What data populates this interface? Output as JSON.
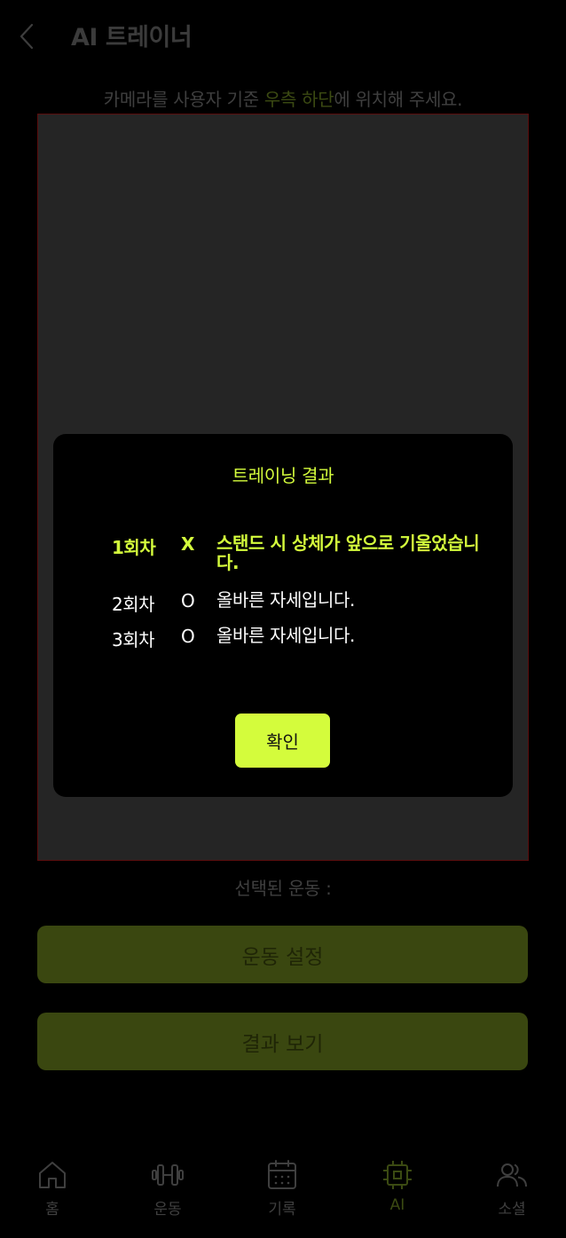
{
  "header": {
    "title": "AI 트레이너"
  },
  "instruction": {
    "pre": "카메라를 사용자 기준 ",
    "highlight": "우측 하단",
    "post": "에 위치해 주세요."
  },
  "modal": {
    "title": "트레이닝 결과",
    "results": [
      {
        "round": "1회차",
        "mark": "X",
        "message": "스탠드 시 상체가 앞으로 기울었습니다.",
        "status": "error"
      },
      {
        "round": "2회차",
        "mark": "O",
        "message": "올바른 자세입니다.",
        "status": "ok"
      },
      {
        "round": "3회차",
        "mark": "O",
        "message": "올바른 자세입니다.",
        "status": "ok"
      }
    ],
    "confirm_label": "확인"
  },
  "selected_exercise": {
    "label": "선택된 운동 :"
  },
  "buttons": {
    "exercise_settings": "운동 설정",
    "view_results": "결과 보기"
  },
  "nav": {
    "items": [
      {
        "label": "홈",
        "icon": "home-icon"
      },
      {
        "label": "운동",
        "icon": "dumbbell-icon"
      },
      {
        "label": "기록",
        "icon": "calendar-icon"
      },
      {
        "label": "AI",
        "icon": "chip-icon",
        "active": true
      },
      {
        "label": "소셜",
        "icon": "users-icon"
      }
    ]
  },
  "colors": {
    "accent": "#d4fc3c",
    "background": "#000000",
    "panel": "#252525",
    "button_dim": "#3a4710",
    "text_dim": "#3f3f3f"
  }
}
